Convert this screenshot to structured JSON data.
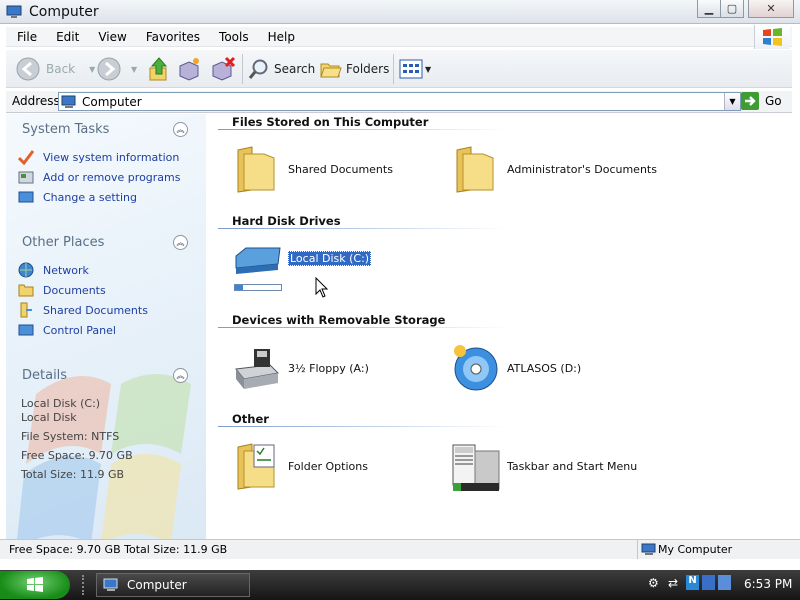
{
  "window": {
    "title": "Computer"
  },
  "menu": [
    "File",
    "Edit",
    "View",
    "Favorites",
    "Tools",
    "Help"
  ],
  "toolbar": {
    "back": "Back",
    "search": "Search",
    "folders": "Folders"
  },
  "address": {
    "label": "Address",
    "value": "Computer",
    "go": "Go"
  },
  "left": {
    "system_tasks": {
      "title": "System Tasks",
      "items": [
        "View system information",
        "Add or remove programs",
        "Change a setting"
      ]
    },
    "other_places": {
      "title": "Other Places",
      "items": [
        "Network",
        "Documents",
        "Shared Documents",
        "Control Panel"
      ]
    },
    "details": {
      "title": "Details",
      "lines": [
        "Local Disk (C:)",
        "Local Disk",
        "File System: NTFS",
        "Free Space: 9.70 GB",
        "Total Size: 11.9 GB"
      ]
    }
  },
  "groups": {
    "files": {
      "title": "Files Stored on This Computer",
      "items": [
        "Shared Documents",
        "Administrator's Documents"
      ]
    },
    "hdd": {
      "title": "Hard Disk Drives",
      "items": [
        "Local Disk (C:)"
      ],
      "usage_fraction": 0.18
    },
    "removable": {
      "title": "Devices with Removable Storage",
      "items": [
        "3½ Floppy (A:)",
        "ATLASOS (D:)"
      ]
    },
    "other": {
      "title": "Other",
      "items": [
        "Folder Options",
        "Taskbar and Start Menu"
      ]
    }
  },
  "status": {
    "left": "Free Space: 9.70 GB Total Size: 11.9 GB",
    "right": "My Computer"
  },
  "taskbar": {
    "task": "Computer",
    "clock": "6:53 PM"
  },
  "colors": {
    "selection": "#316ac5",
    "link": "#1d3fa0",
    "start": "#2aa52a"
  }
}
